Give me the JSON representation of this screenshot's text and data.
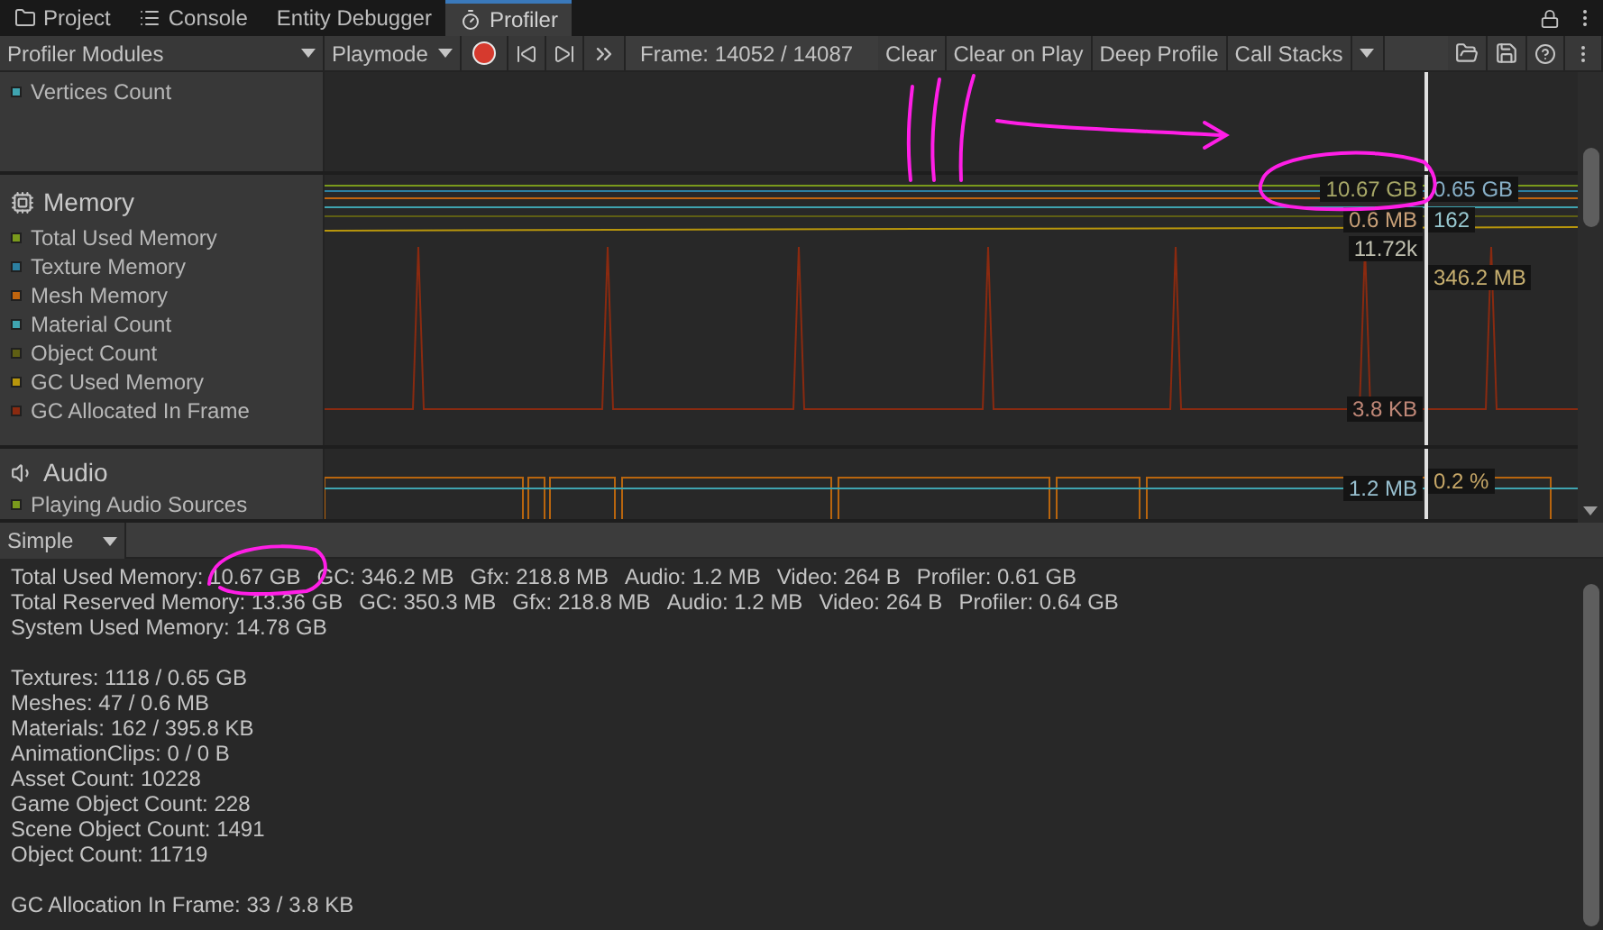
{
  "tabs": [
    {
      "label": "Project",
      "selected": false
    },
    {
      "label": "Console",
      "selected": false
    },
    {
      "label": "Entity Debugger",
      "selected": false
    },
    {
      "label": "Profiler",
      "selected": true
    }
  ],
  "toolbar": {
    "modules_dropdown": "Profiler Modules",
    "mode_dropdown": "Playmode",
    "recording": true,
    "frame": "Frame: 14052 / 14087",
    "buttons": [
      "Clear",
      "Clear on Play",
      "Deep Profile"
    ],
    "call_stacks": "Call Stacks"
  },
  "modules": [
    {
      "kind": "vertices",
      "series": [
        {
          "name": "Vertices Count",
          "color": "#3fa4b0"
        }
      ]
    },
    {
      "kind": "memory",
      "title": "Memory",
      "series": [
        {
          "name": "Total Used Memory",
          "color": "#7a9a1c"
        },
        {
          "name": "Texture Memory",
          "color": "#2c7fa0"
        },
        {
          "name": "Mesh Memory",
          "color": "#c0650e"
        },
        {
          "name": "Material Count",
          "color": "#3fa4b0"
        },
        {
          "name": "Object Count",
          "color": "#5f5f14"
        },
        {
          "name": "GC Used Memory",
          "color": "#b8960c"
        },
        {
          "name": "GC Allocated In Frame",
          "color": "#8a2a10"
        }
      ],
      "values_before_cursor": [
        {
          "text": "10.67 GB",
          "color": "#a8a868"
        },
        {
          "text": "0.6 MB",
          "color": "#c8a078"
        },
        {
          "text": "11.72k",
          "color": "#c0c0b0"
        },
        {
          "text": "3.8 KB",
          "color": "#c08878"
        }
      ],
      "values_after_cursor": [
        {
          "text": "0.65 GB",
          "color": "#88b0c8"
        },
        {
          "text": "162",
          "color": "#98c8d0"
        },
        {
          "text": "346.2 MB",
          "color": "#c8b070"
        }
      ]
    },
    {
      "kind": "audio",
      "title": "Audio",
      "series": [
        {
          "name": "Playing Audio Sources",
          "color": "#7a9a1c"
        }
      ],
      "values_before_cursor": [
        {
          "text": "1.2 MB",
          "color": "#98c0d0"
        }
      ],
      "values_after_cursor": [
        {
          "text": "0.2 %",
          "color": "#c8a868"
        }
      ]
    }
  ],
  "details": {
    "view_dropdown": "Simple",
    "groups": [
      [
        [
          "Total Used Memory: 10.67 GB",
          "GC: 346.2 MB",
          "Gfx: 218.8 MB",
          "Audio: 1.2 MB",
          "Video: 264 B",
          "Profiler: 0.61 GB"
        ],
        [
          "Total Reserved Memory: 13.36 GB",
          "GC: 350.3 MB",
          "Gfx: 218.8 MB",
          "Audio: 1.2 MB",
          "Video: 264 B",
          "Profiler: 0.64 GB"
        ],
        [
          "System Used Memory: 14.78 GB"
        ]
      ],
      [
        [
          "Textures: 1118 / 0.65 GB"
        ],
        [
          "Meshes: 47 / 0.6 MB"
        ],
        [
          "Materials: 162 / 395.8 KB"
        ],
        [
          "AnimationClips: 0 / 0 B"
        ],
        [
          "Asset Count: 10228"
        ],
        [
          "Game Object Count: 228"
        ],
        [
          "Scene Object Count: 1491"
        ],
        [
          "Object Count: 11719"
        ]
      ],
      [
        [
          "GC Allocation In Frame: 33 / 3.8 KB"
        ]
      ]
    ]
  }
}
